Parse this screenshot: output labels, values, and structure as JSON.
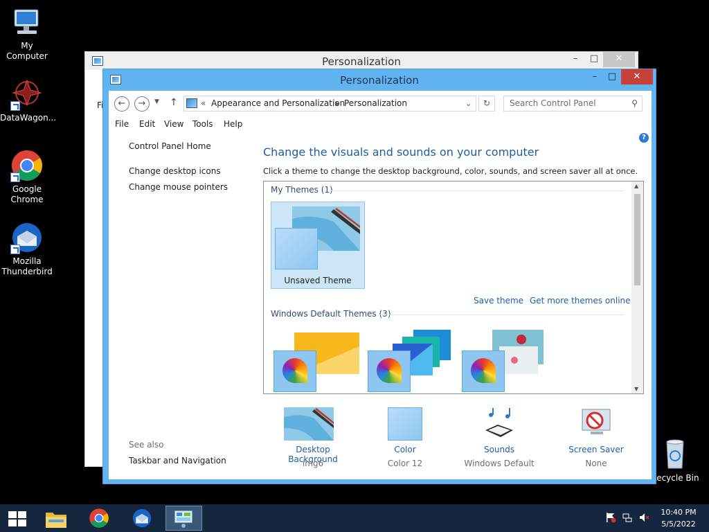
{
  "desktop": {
    "icons": [
      {
        "label": "My Computer"
      },
      {
        "label": "DataWagon..."
      },
      {
        "label": "Google Chrome"
      },
      {
        "label": "Mozilla Thunderbird"
      },
      {
        "label": "Recycle Bin"
      }
    ]
  },
  "back_window": {
    "title": "Personalization",
    "partial_menu": "Fi"
  },
  "window": {
    "title": "Personalization",
    "controls": {
      "minimize": "–",
      "maximize": "□",
      "close": "✕"
    }
  },
  "address": {
    "overflow": "«",
    "crumbs": [
      "Appearance and Personalization",
      "Personalization"
    ],
    "search_placeholder": "Search Control Panel"
  },
  "menu": [
    "File",
    "Edit",
    "View",
    "Tools",
    "Help"
  ],
  "left_pane": {
    "home": "Control Panel Home",
    "links": [
      "Change desktop icons",
      "Change mouse pointers"
    ],
    "see_also_title": "See also",
    "see_also": [
      "Taskbar and Navigation"
    ]
  },
  "main": {
    "heading": "Change the visuals and sounds on your computer",
    "subheading": "Click a theme to change the desktop background, color, sounds, and screen saver all at once.",
    "help": "?",
    "my_themes": {
      "title": "My Themes (1)",
      "items": [
        {
          "label": "Unsaved Theme",
          "selected": true
        }
      ]
    },
    "actions": {
      "save": "Save theme",
      "more": "Get more themes online"
    },
    "default_themes": {
      "title": "Windows Default Themes (3)",
      "count": 3
    }
  },
  "quick_links": [
    {
      "label": "Desktop Background",
      "value": "img6"
    },
    {
      "label": "Color",
      "value": "Color 12"
    },
    {
      "label": "Sounds",
      "value": "Windows Default"
    },
    {
      "label": "Screen Saver",
      "value": "None"
    }
  ],
  "taskbar": {
    "apps": [
      "start",
      "file-explorer",
      "chrome",
      "thunderbird",
      "control-panel"
    ],
    "active": "control-panel",
    "time": "10:40 PM",
    "date": "5/5/2022"
  },
  "colors": {
    "window_frame": "#62b4f0",
    "link": "#1d5da5",
    "close_button": "#c7403a",
    "taskbar": "#15263f"
  }
}
